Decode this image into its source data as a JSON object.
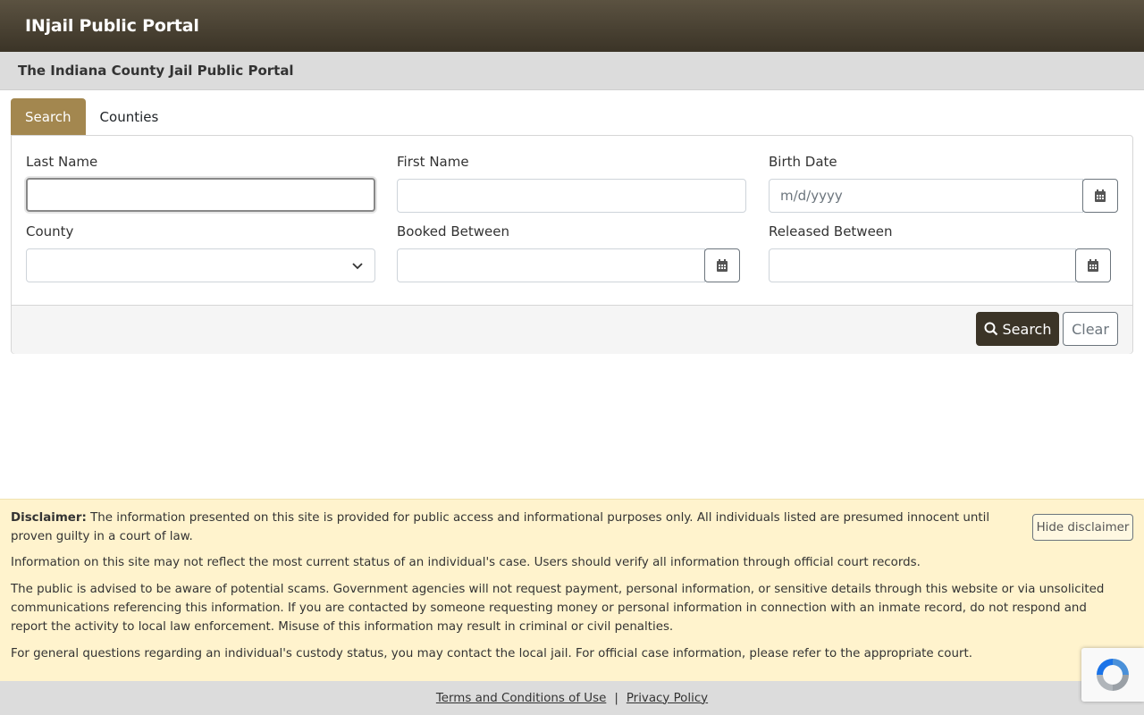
{
  "header": {
    "brand": "INjail Public Portal"
  },
  "subheader": {
    "title": "The Indiana County Jail Public Portal"
  },
  "tabs": [
    {
      "label": "Search",
      "active": true
    },
    {
      "label": "Counties",
      "active": false
    }
  ],
  "form": {
    "last_name": {
      "label": "Last Name",
      "value": ""
    },
    "first_name": {
      "label": "First Name",
      "value": ""
    },
    "birth_date": {
      "label": "Birth Date",
      "placeholder": "m/d/yyyy"
    },
    "county": {
      "label": "County",
      "value": ""
    },
    "booked_between": {
      "label": "Booked Between",
      "value": ""
    },
    "released_between": {
      "label": "Released Between",
      "value": ""
    }
  },
  "actions": {
    "search_label": "Search",
    "clear_label": "Clear"
  },
  "disclaimer": {
    "heading": "Disclaimer:",
    "p1": "The information presented on this site is provided for public access and informational purposes only. All individuals listed are presumed innocent until proven guilty in a court of law.",
    "p2": "Information on this site may not reflect the most current status of an individual's case. Users should verify all information through official court records.",
    "p3": "The public is advised to be aware of potential scams. Government agencies will not request payment, personal information, or sensitive details through this website or via unsolicited communications referencing this information. If you are contacted by someone requesting money or personal information in connection with an inmate record, do not respond and report the activity to local law enforcement. Misuse of this information may result in criminal or civil penalties.",
    "p4": "For general questions regarding an individual's custody status, you may contact the local jail. For official case information, please refer to the appropriate court.",
    "hide_label": "Hide disclaimer"
  },
  "footer": {
    "terms": "Terms and Conditions of Use",
    "separator": "|",
    "privacy": "Privacy Policy"
  },
  "colors": {
    "header": "#3b3427",
    "accent": "#a3874f",
    "disclaimer_bg": "#fff3cd"
  },
  "icons": [
    "calendar-icon",
    "chevron-down-icon",
    "search-icon",
    "recaptcha-icon"
  ]
}
